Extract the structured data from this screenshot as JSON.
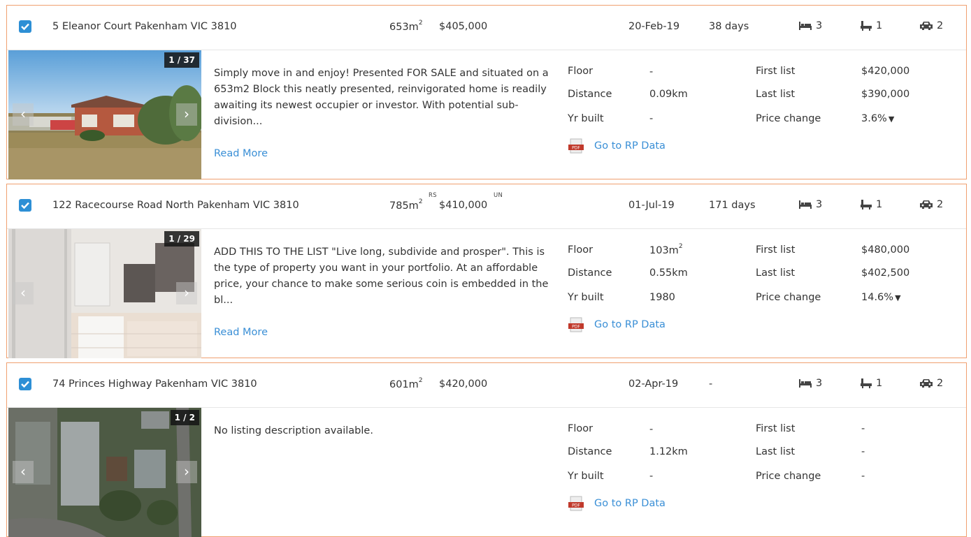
{
  "listings": [
    {
      "address": "5 Eleanor Court Pakenham VIC 3810",
      "land_size": "653m",
      "land_unit_sup": "2",
      "price": "$405,000",
      "price_tag_left": "",
      "price_tag_right": "",
      "date": "20-Feb-19",
      "days": "38 days",
      "beds": "3",
      "baths": "1",
      "cars": "2",
      "photo_counter": "1 / 37",
      "photo_kind": "house",
      "description": "Simply move in and enjoy! Presented FOR SALE and situated on a 653m2 Block this neatly presented, reinvigorated home is readily awaiting its newest occupier or investor. With potential sub-division...",
      "read_more": "Read More",
      "floor": "-",
      "floor_sup": "",
      "distance": "0.09km",
      "yr_built": "-",
      "first_list": "$420,000",
      "last_list": "$390,000",
      "price_change": "3.6%",
      "price_change_arrow": "▼"
    },
    {
      "address": "122 Racecourse Road North Pakenham VIC 3810",
      "land_size": "785m",
      "land_unit_sup": "2",
      "price": "$410,000",
      "price_tag_left": "RS",
      "price_tag_right": "UN",
      "date": "01-Jul-19",
      "days": "171 days",
      "beds": "3",
      "baths": "1",
      "cars": "2",
      "photo_counter": "1 / 29",
      "photo_kind": "bathroom",
      "description": "ADD THIS TO THE LIST \"Live long, subdivide and prosper\". This is the type of property you want in your portfolio. At an affordable price, your chance to make some serious coin is embedded in the bl...",
      "read_more": "Read More",
      "floor": "103m",
      "floor_sup": "2",
      "distance": "0.55km",
      "yr_built": "1980",
      "first_list": "$480,000",
      "last_list": "$402,500",
      "price_change": "14.6%",
      "price_change_arrow": "▼"
    },
    {
      "address": "74 Princes Highway Pakenham VIC 3810",
      "land_size": "601m",
      "land_unit_sup": "2",
      "price": "$420,000",
      "price_tag_left": "",
      "price_tag_right": "",
      "date": "02-Apr-19",
      "days": "-",
      "beds": "3",
      "baths": "1",
      "cars": "2",
      "photo_counter": "1 / 2",
      "photo_kind": "aerial",
      "description": "No listing description available.",
      "read_more": "",
      "floor": "-",
      "floor_sup": "",
      "distance": "1.12km",
      "yr_built": "-",
      "first_list": "-",
      "last_list": "-",
      "price_change": "-",
      "price_change_arrow": ""
    }
  ],
  "labels": {
    "floor": "Floor",
    "distance": "Distance",
    "yr_built": "Yr built",
    "first_list": "First list",
    "last_list": "Last list",
    "price_change": "Price change",
    "rp_link": "Go to RP Data",
    "prev": "‹",
    "next": "›"
  },
  "colors": {
    "accent": "#2d8fd5",
    "link": "#3a8fd6",
    "card_border": "#f0a070"
  },
  "icons": [
    "checkbox-checked-icon",
    "bed-icon",
    "bath-icon",
    "car-icon",
    "pdf-icon",
    "chevron-left-icon",
    "chevron-right-icon"
  ]
}
